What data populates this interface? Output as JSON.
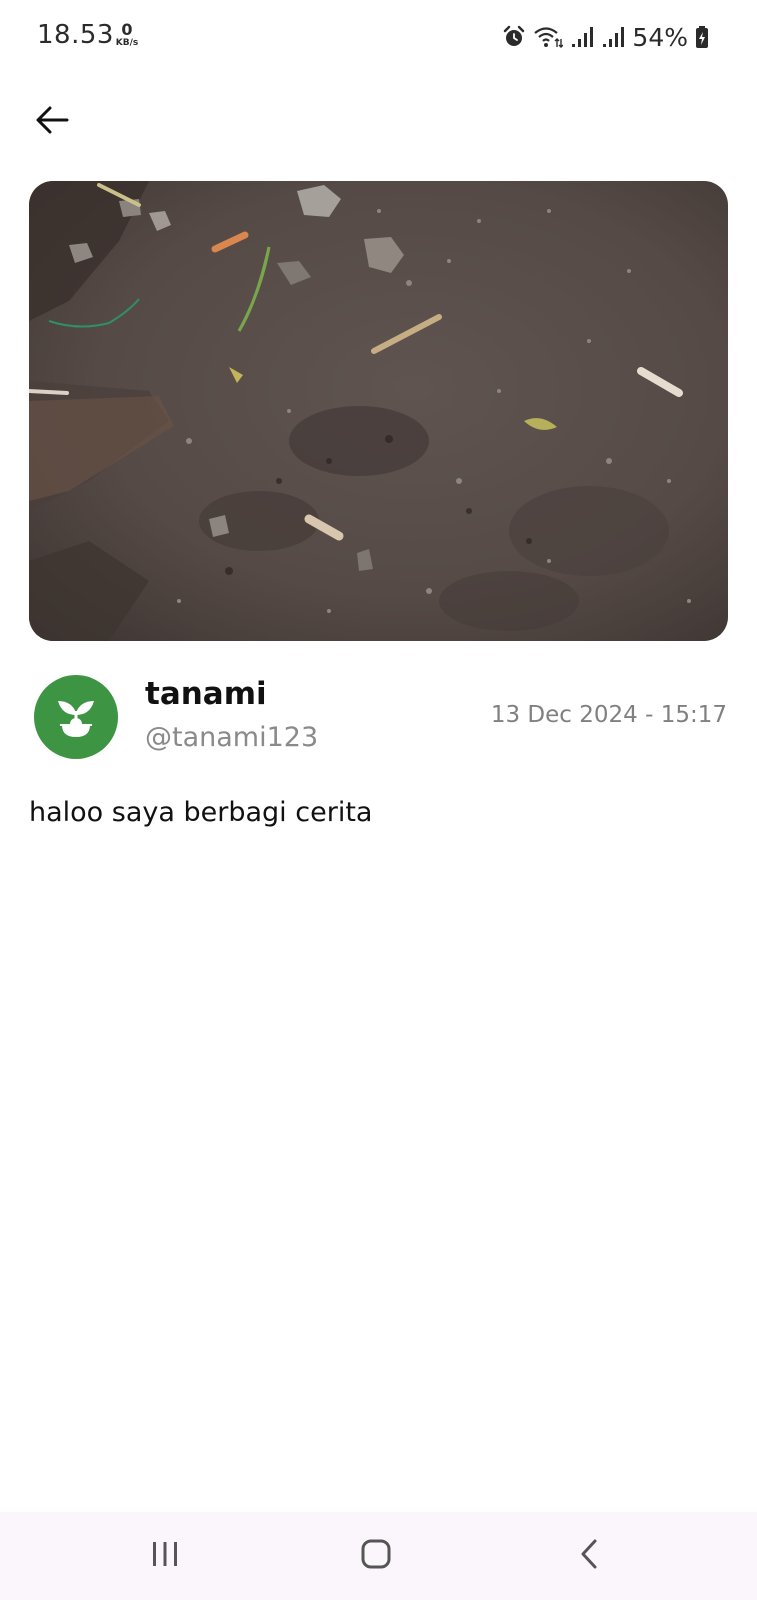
{
  "status_bar": {
    "time": "18.53",
    "net_speed_value": "0",
    "net_speed_unit": "KB/s",
    "battery_percent": "54%",
    "icons": [
      "alarm-icon",
      "wifi-icon",
      "signal-icon",
      "signal-icon",
      "battery-charging-icon"
    ]
  },
  "toolbar": {
    "back_icon": "arrow-left-icon"
  },
  "post": {
    "image_description": "photo",
    "author_name": "tanami",
    "author_handle": "@tanami123",
    "date": "13 Dec 2024 - 15:17",
    "body": "haloo saya berbagi cerita",
    "avatar_icon": "sprout-icon"
  },
  "colors": {
    "avatar_bg": "#3d9443",
    "nav_bar_bg": "#fbf6fb",
    "handle_text": "#8a8a8a"
  },
  "nav_bar": {
    "icons": [
      "recent-apps-icon",
      "home-icon",
      "back-nav-icon"
    ]
  }
}
